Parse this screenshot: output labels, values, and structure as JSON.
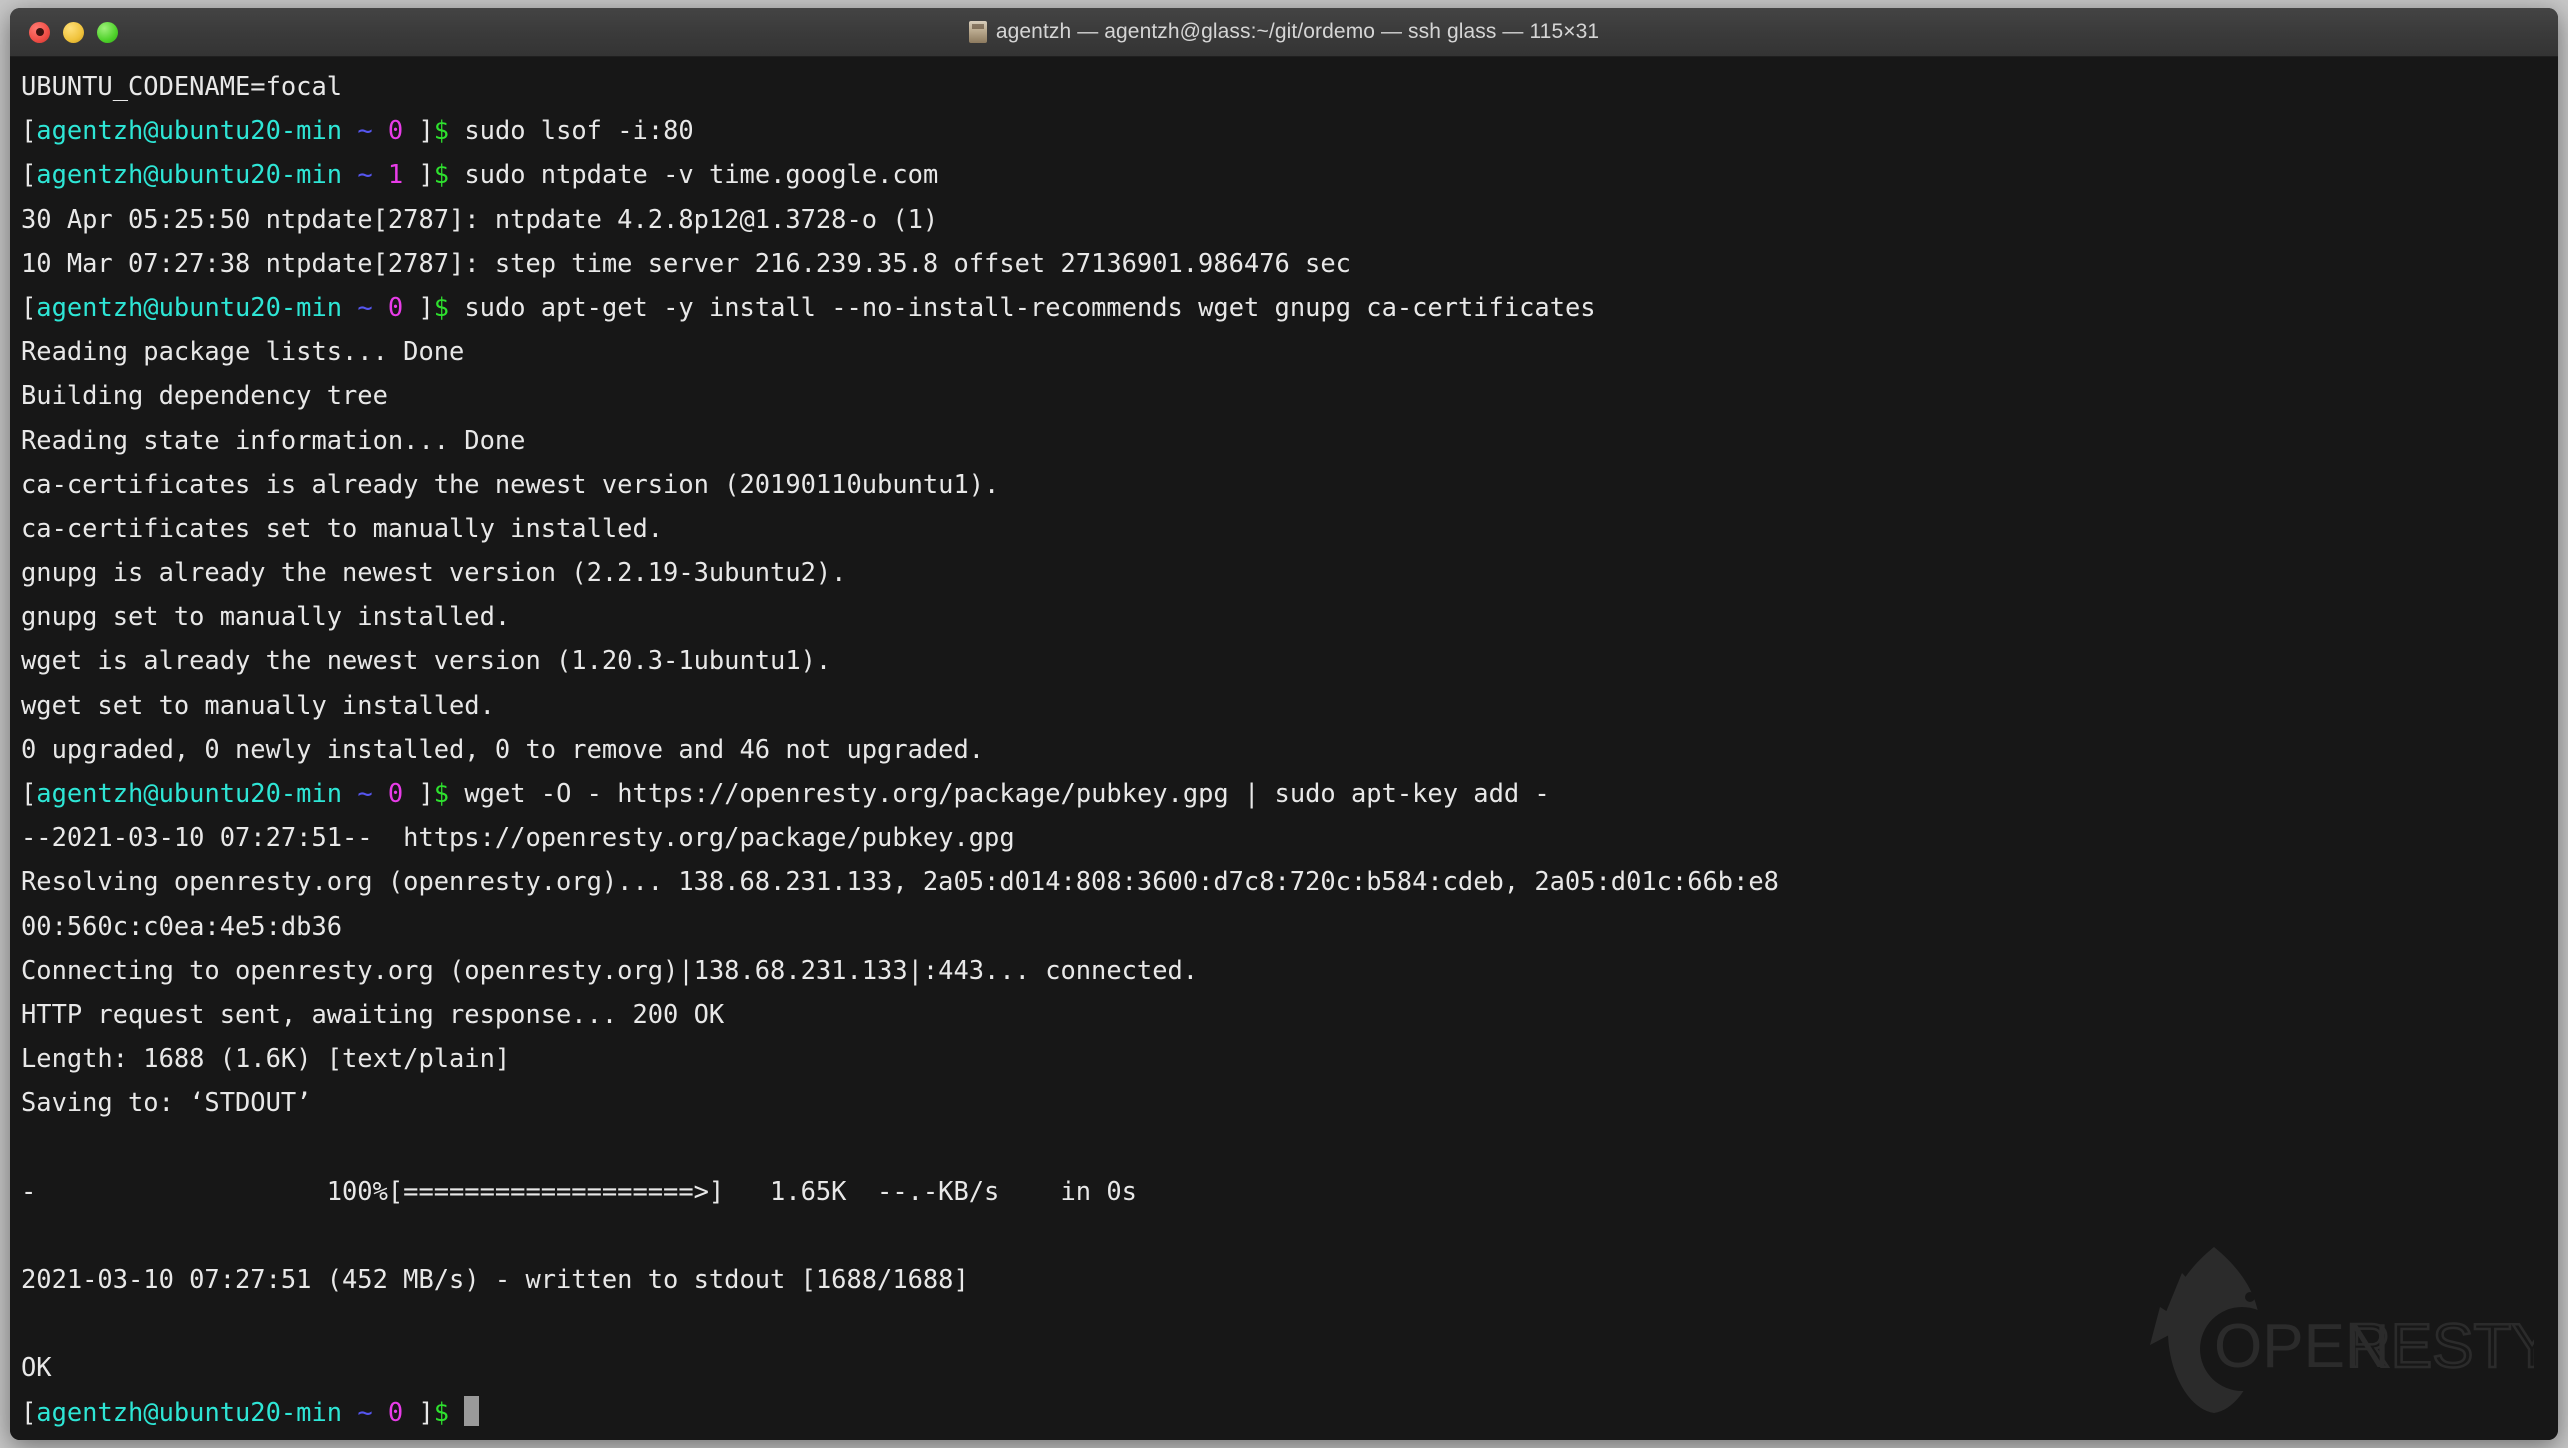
{
  "window": {
    "title": "agentzh — agentzh@glass:~/git/ordemo — ssh glass — 115×31",
    "traffic_lights": [
      "close-button",
      "minimize-button",
      "zoom-button"
    ],
    "title_icon": "folder-terminal-icon",
    "colors": {
      "titlebar_bg": "#3a3a3a",
      "terminal_bg": "#171717",
      "foreground": "#e8e8e8",
      "cyan": "#2ee6d6",
      "blue": "#5656f0",
      "magenta": "#e83ce8",
      "green": "#2ee02e",
      "cursor": "#9a9a9a"
    }
  },
  "watermark": {
    "label": "OPENRESTY",
    "icon": "openresty-bird-logo"
  },
  "terminal": {
    "prompt": {
      "open_bracket": "[",
      "userhost": "agentzh@ubuntu20-min",
      "cwd": "~",
      "status_ok": "0",
      "status_err": "1",
      "close_bracket": "]",
      "sigil": "$"
    },
    "lines": [
      {
        "type": "output",
        "text": "UBUNTU_CODENAME=focal"
      },
      {
        "type": "prompt",
        "status": "0",
        "command": "sudo lsof -i:80"
      },
      {
        "type": "prompt",
        "status": "1",
        "command": "sudo ntpdate -v time.google.com"
      },
      {
        "type": "output",
        "text": "30 Apr 05:25:50 ntpdate[2787]: ntpdate 4.2.8p12@1.3728-o (1)"
      },
      {
        "type": "output",
        "text": "10 Mar 07:27:38 ntpdate[2787]: step time server 216.239.35.8 offset 27136901.986476 sec"
      },
      {
        "type": "prompt",
        "status": "0",
        "command": "sudo apt-get -y install --no-install-recommends wget gnupg ca-certificates"
      },
      {
        "type": "output",
        "text": "Reading package lists... Done"
      },
      {
        "type": "output",
        "text": "Building dependency tree"
      },
      {
        "type": "output",
        "text": "Reading state information... Done"
      },
      {
        "type": "output",
        "text": "ca-certificates is already the newest version (20190110ubuntu1)."
      },
      {
        "type": "output",
        "text": "ca-certificates set to manually installed."
      },
      {
        "type": "output",
        "text": "gnupg is already the newest version (2.2.19-3ubuntu2)."
      },
      {
        "type": "output",
        "text": "gnupg set to manually installed."
      },
      {
        "type": "output",
        "text": "wget is already the newest version (1.20.3-1ubuntu1)."
      },
      {
        "type": "output",
        "text": "wget set to manually installed."
      },
      {
        "type": "output",
        "text": "0 upgraded, 0 newly installed, 0 to remove and 46 not upgraded."
      },
      {
        "type": "prompt",
        "status": "0",
        "command": "wget -O - https://openresty.org/package/pubkey.gpg | sudo apt-key add -"
      },
      {
        "type": "output",
        "text": "--2021-03-10 07:27:51--  https://openresty.org/package/pubkey.gpg"
      },
      {
        "type": "output",
        "text": "Resolving openresty.org (openresty.org)... 138.68.231.133, 2a05:d014:808:3600:d7c8:720c:b584:cdeb, 2a05:d01c:66b:e8"
      },
      {
        "type": "output",
        "text": "00:560c:c0ea:4e5:db36"
      },
      {
        "type": "output",
        "text": "Connecting to openresty.org (openresty.org)|138.68.231.133|:443... connected."
      },
      {
        "type": "output",
        "text": "HTTP request sent, awaiting response... 200 OK"
      },
      {
        "type": "output",
        "text": "Length: 1688 (1.6K) [text/plain]"
      },
      {
        "type": "output",
        "text": "Saving to: ‘STDOUT’"
      },
      {
        "type": "output",
        "text": ""
      },
      {
        "type": "output",
        "text": "-                   100%[===================>]   1.65K  --.-KB/s    in 0s"
      },
      {
        "type": "output",
        "text": ""
      },
      {
        "type": "output",
        "text": "2021-03-10 07:27:51 (452 MB/s) - written to stdout [1688/1688]"
      },
      {
        "type": "output",
        "text": ""
      },
      {
        "type": "output",
        "text": "OK"
      },
      {
        "type": "prompt_cursor",
        "status": "0",
        "command": ""
      }
    ],
    "progress_bar": {
      "percent": "100%",
      "filled": "===================================================",
      "arrow": ">",
      "size": "1.65K",
      "rate": "--.-KB/s",
      "elapsed": "in 0s"
    }
  }
}
